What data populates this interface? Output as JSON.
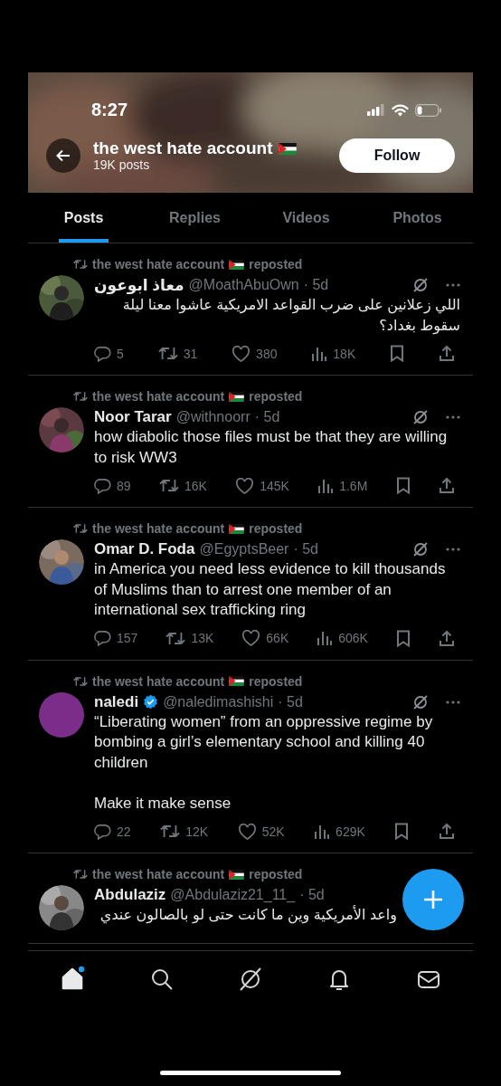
{
  "status_bar": {
    "time": "8:27"
  },
  "header": {
    "title": "the west hate account",
    "posts_count": "19K posts",
    "follow_label": "Follow"
  },
  "tabs": [
    {
      "label": "Posts",
      "selected": true
    },
    {
      "label": "Replies",
      "selected": false
    },
    {
      "label": "Videos",
      "selected": false
    },
    {
      "label": "Photos",
      "selected": false
    }
  ],
  "posts": [
    {
      "reposted_by": "the west hate account",
      "repost_label": "reposted",
      "name": "معاذ ابوعون",
      "verified": false,
      "handle": "@MoathAbuOwn",
      "time": "· 5d",
      "text": "اللي زعلانين على ضرب القواعد الامريكية عاشوا معنا ليلة سقوط بغداد؟",
      "rtl": true,
      "stats": {
        "replies": "5",
        "reposts": "31",
        "likes": "380",
        "views": "18K"
      }
    },
    {
      "reposted_by": "the west hate account",
      "repost_label": "reposted",
      "name": "Noor Tarar",
      "verified": false,
      "handle": "@withnoorr",
      "time": "· 5d",
      "text": "how diabolic those files must be that they are willing to risk WW3",
      "rtl": false,
      "stats": {
        "replies": "89",
        "reposts": "16K",
        "likes": "145K",
        "views": "1.6M"
      }
    },
    {
      "reposted_by": "the west hate account",
      "repost_label": "reposted",
      "name": "Omar D. Foda",
      "verified": false,
      "handle": "@EgyptsBeer",
      "time": "· 5d",
      "text": "in America you need less evidence to kill thousands of Muslims than to arrest one member of an international sex trafficking ring",
      "rtl": false,
      "stats": {
        "replies": "157",
        "reposts": "13K",
        "likes": "66K",
        "views": "606K"
      }
    },
    {
      "reposted_by": "the west hate account",
      "repost_label": "reposted",
      "avatar": {
        "kind": "plain",
        "color": "#7a2e8a"
      },
      "name": "naledi",
      "verified": true,
      "handle": "@naledimashishi",
      "time": "· 5d",
      "text": "“Liberating women” from an oppressive regime by bombing a girl’s elementary school and killing 40 children\n\nMake it make sense",
      "rtl": false,
      "stats": {
        "replies": "22",
        "reposts": "12K",
        "likes": "52K",
        "views": "629K"
      }
    },
    {
      "reposted_by": "the west hate account",
      "repost_label": "reposted",
      "name": "Abdulaziz",
      "verified": false,
      "handle": "@Abdulaziz21_11_",
      "time": "· 5d",
      "text": "واعد الأمريكية وين ما كانت حتى لو بالصالون عندي",
      "rtl": true
    }
  ],
  "nav": [
    {
      "kind": "home",
      "selected": true,
      "dot": true
    },
    {
      "kind": "search",
      "selected": false,
      "dot": false
    },
    {
      "kind": "grok",
      "selected": false,
      "dot": false
    },
    {
      "kind": "bell",
      "selected": false,
      "dot": false
    },
    {
      "kind": "mail",
      "selected": false,
      "dot": false
    }
  ]
}
